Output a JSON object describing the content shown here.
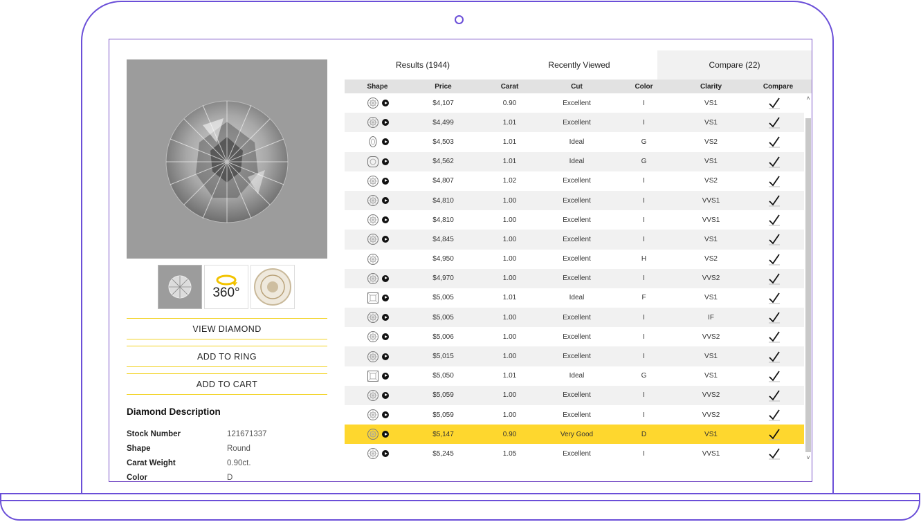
{
  "tabs": {
    "results": "Results (1944)",
    "recent": "Recently Viewed",
    "compare": "Compare (22)"
  },
  "columns": {
    "shape": "Shape",
    "price": "Price",
    "carat": "Carat",
    "cut": "Cut",
    "color": "Color",
    "clarity": "Clarity",
    "compare": "Compare"
  },
  "rows": [
    {
      "shape": "round",
      "video": true,
      "price": "$4,107",
      "carat": "0.90",
      "cut": "Excellent",
      "color": "I",
      "clarity": "VS1",
      "compared": true
    },
    {
      "shape": "round",
      "video": true,
      "price": "$4,499",
      "carat": "1.01",
      "cut": "Excellent",
      "color": "I",
      "clarity": "VS1",
      "compared": true
    },
    {
      "shape": "oval",
      "video": true,
      "price": "$4,503",
      "carat": "1.01",
      "cut": "Ideal",
      "color": "G",
      "clarity": "VS2",
      "compared": true
    },
    {
      "shape": "cushion",
      "video": true,
      "price": "$4,562",
      "carat": "1.01",
      "cut": "Ideal",
      "color": "G",
      "clarity": "VS1",
      "compared": true
    },
    {
      "shape": "round",
      "video": true,
      "price": "$4,807",
      "carat": "1.02",
      "cut": "Excellent",
      "color": "I",
      "clarity": "VS2",
      "compared": true
    },
    {
      "shape": "round",
      "video": true,
      "price": "$4,810",
      "carat": "1.00",
      "cut": "Excellent",
      "color": "I",
      "clarity": "VVS1",
      "compared": true
    },
    {
      "shape": "round",
      "video": true,
      "price": "$4,810",
      "carat": "1.00",
      "cut": "Excellent",
      "color": "I",
      "clarity": "VVS1",
      "compared": true
    },
    {
      "shape": "round",
      "video": true,
      "price": "$4,845",
      "carat": "1.00",
      "cut": "Excellent",
      "color": "I",
      "clarity": "VS1",
      "compared": true
    },
    {
      "shape": "round",
      "video": false,
      "price": "$4,950",
      "carat": "1.00",
      "cut": "Excellent",
      "color": "H",
      "clarity": "VS2",
      "compared": true
    },
    {
      "shape": "round",
      "video": true,
      "price": "$4,970",
      "carat": "1.00",
      "cut": "Excellent",
      "color": "I",
      "clarity": "VVS2",
      "compared": true
    },
    {
      "shape": "princess",
      "video": true,
      "price": "$5,005",
      "carat": "1.01",
      "cut": "Ideal",
      "color": "F",
      "clarity": "VS1",
      "compared": true
    },
    {
      "shape": "round",
      "video": true,
      "price": "$5,005",
      "carat": "1.00",
      "cut": "Excellent",
      "color": "I",
      "clarity": "IF",
      "compared": true
    },
    {
      "shape": "round",
      "video": true,
      "price": "$5,006",
      "carat": "1.00",
      "cut": "Excellent",
      "color": "I",
      "clarity": "VVS2",
      "compared": true
    },
    {
      "shape": "round",
      "video": true,
      "price": "$5,015",
      "carat": "1.00",
      "cut": "Excellent",
      "color": "I",
      "clarity": "VS1",
      "compared": true
    },
    {
      "shape": "princess",
      "video": true,
      "price": "$5,050",
      "carat": "1.01",
      "cut": "Ideal",
      "color": "G",
      "clarity": "VS1",
      "compared": true
    },
    {
      "shape": "round",
      "video": true,
      "price": "$5,059",
      "carat": "1.00",
      "cut": "Excellent",
      "color": "I",
      "clarity": "VVS2",
      "compared": true
    },
    {
      "shape": "round",
      "video": true,
      "price": "$5,059",
      "carat": "1.00",
      "cut": "Excellent",
      "color": "I",
      "clarity": "VVS2",
      "compared": true
    },
    {
      "shape": "round",
      "video": true,
      "price": "$5,147",
      "carat": "0.90",
      "cut": "Very Good",
      "color": "D",
      "clarity": "VS1",
      "compared": true,
      "highlighted": true
    },
    {
      "shape": "round",
      "video": true,
      "price": "$5,245",
      "carat": "1.05",
      "cut": "Excellent",
      "color": "I",
      "clarity": "VVS1",
      "compared": true
    }
  ],
  "buttons": {
    "view": "VIEW DIAMOND",
    "ring": "ADD TO RING",
    "cart": "ADD TO CART"
  },
  "thumbs": {
    "label_360": "360°"
  },
  "description": {
    "title": "Diamond Description",
    "specs": [
      {
        "label": "Stock Number",
        "value": "121671337"
      },
      {
        "label": "Shape",
        "value": "Round"
      },
      {
        "label": "Carat Weight",
        "value": "0.90ct."
      },
      {
        "label": "Color",
        "value": "D"
      }
    ]
  },
  "colors": {
    "highlight": "#fed72e",
    "button_border": "#f2d21f",
    "frame": "#6b4fd8"
  }
}
